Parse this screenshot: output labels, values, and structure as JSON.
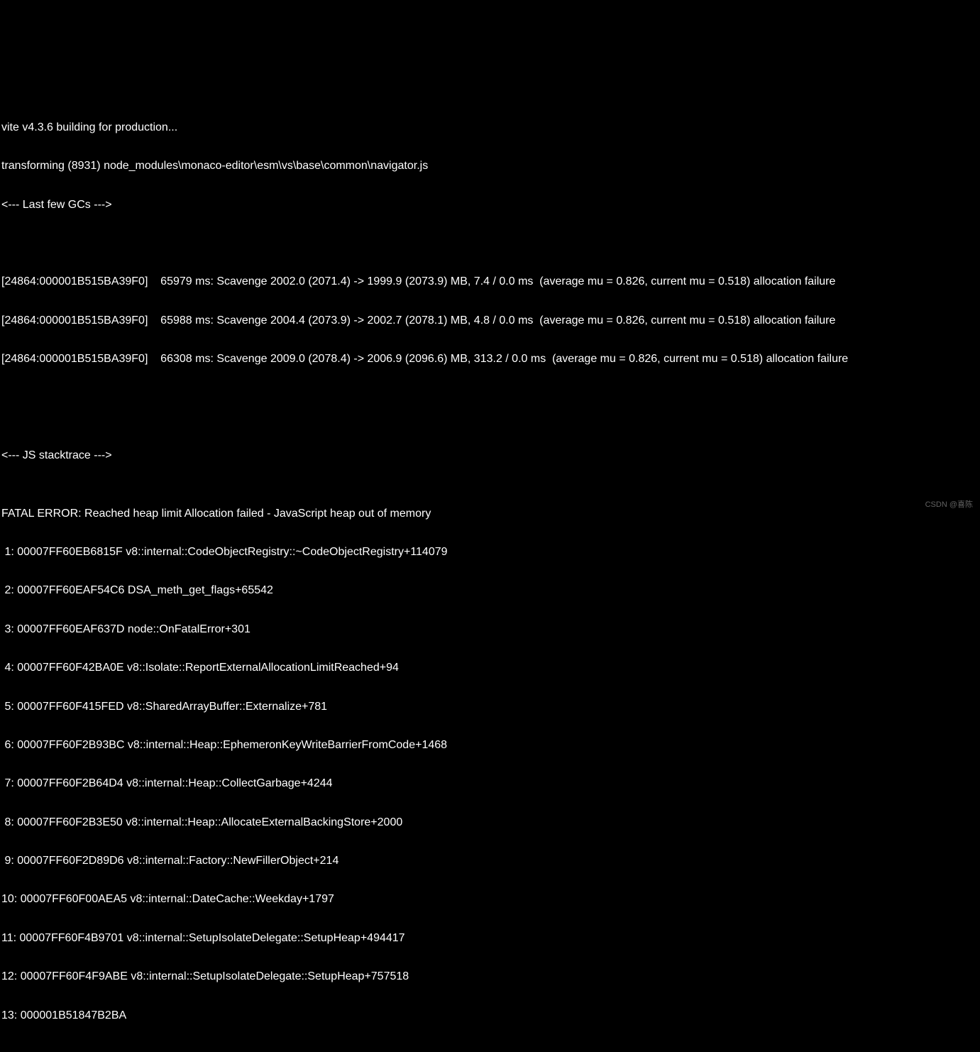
{
  "terminal": {
    "lines": [
      "vite v4.3.6 building for production...",
      "transforming (8931) node_modules\\monaco-editor\\esm\\vs\\base\\common\\navigator.js",
      "<--- Last few GCs --->",
      "",
      "",
      "[24864:000001B515BA39F0]    65979 ms: Scavenge 2002.0 (2071.4) -> 1999.9 (2073.9) MB, 7.4 / 0.0 ms  (average mu = 0.826, current mu = 0.518) allocation failure",
      "[24864:000001B515BA39F0]    65988 ms: Scavenge 2004.4 (2073.9) -> 2002.7 (2078.1) MB, 4.8 / 0.0 ms  (average mu = 0.826, current mu = 0.518) allocation failure",
      "[24864:000001B515BA39F0]    66308 ms: Scavenge 2009.0 (2078.4) -> 2006.9 (2096.6) MB, 313.2 / 0.0 ms  (average mu = 0.826, current mu = 0.518) allocation failure",
      "",
      "",
      "",
      "<--- JS stacktrace --->",
      "",
      "FATAL ERROR: Reached heap limit Allocation failed - JavaScript heap out of memory",
      " 1: 00007FF60EB6815F v8::internal::CodeObjectRegistry::~CodeObjectRegistry+114079",
      " 2: 00007FF60EAF54C6 DSA_meth_get_flags+65542",
      " 3: 00007FF60EAF637D node::OnFatalError+301",
      " 4: 00007FF60F42BA0E v8::Isolate::ReportExternalAllocationLimitReached+94",
      " 5: 00007FF60F415FED v8::SharedArrayBuffer::Externalize+781",
      " 6: 00007FF60F2B93BC v8::internal::Heap::EphemeronKeyWriteBarrierFromCode+1468",
      " 7: 00007FF60F2B64D4 v8::internal::Heap::CollectGarbage+4244",
      " 8: 00007FF60F2B3E50 v8::internal::Heap::AllocateExternalBackingStore+2000",
      " 9: 00007FF60F2D89D6 v8::internal::Factory::NewFillerObject+214",
      "10: 00007FF60F00AEA5 v8::internal::DateCache::Weekday+1797",
      "11: 00007FF60F4B9701 v8::internal::SetupIsolateDelegate::SetupHeap+494417",
      "12: 00007FF60F4F9ABE v8::internal::SetupIsolateDelegate::SetupHeap+757518",
      "13: 000001B51847B2BA"
    ]
  },
  "watermark": "CSDN @喜陈"
}
